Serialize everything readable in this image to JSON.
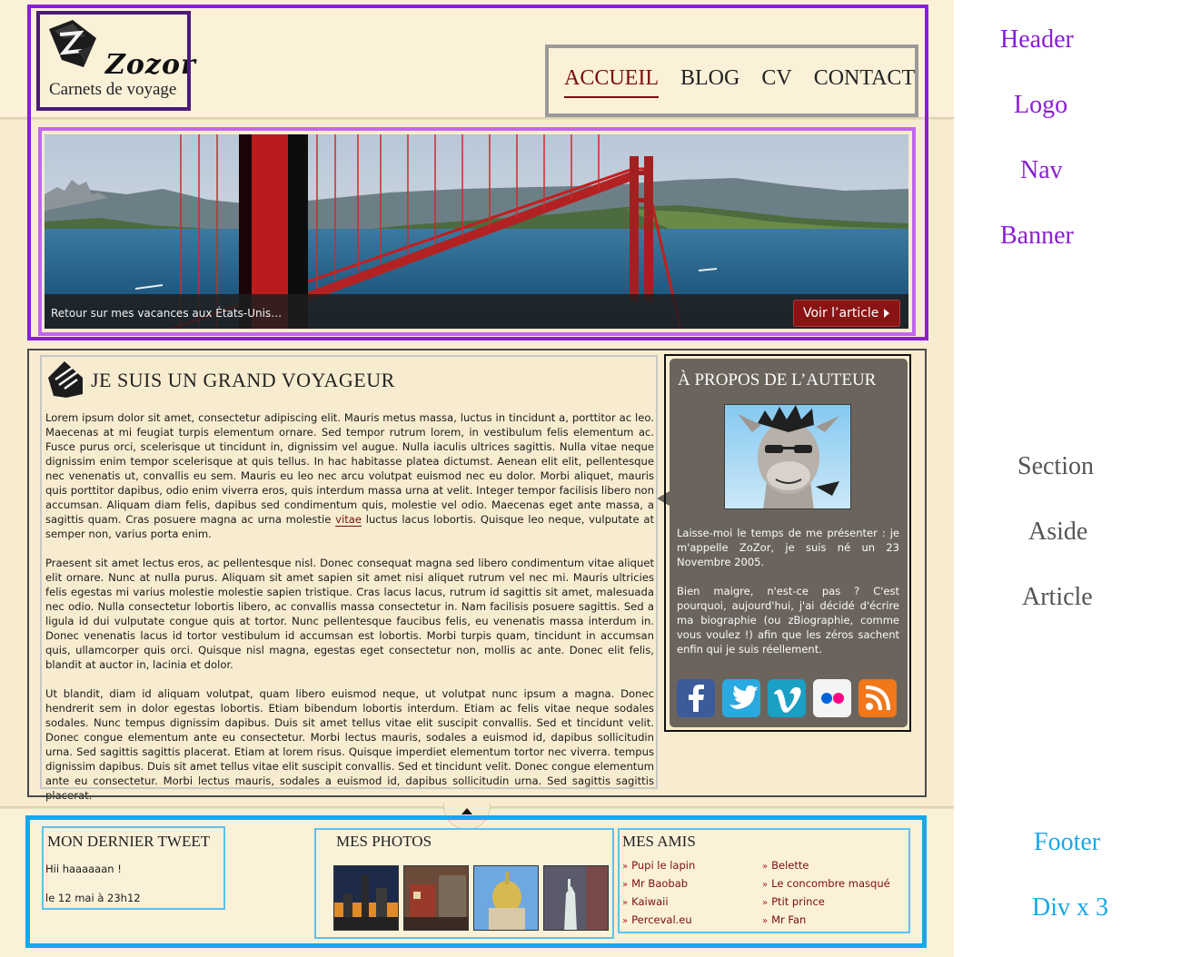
{
  "logo": {
    "name": "Zozor",
    "tagline": "Carnets de voyage"
  },
  "nav": {
    "items": [
      {
        "label": "ACCUEIL",
        "active": true
      },
      {
        "label": "BLOG",
        "active": false
      },
      {
        "label": "CV",
        "active": false
      },
      {
        "label": "CONTACT",
        "active": false
      }
    ]
  },
  "banner": {
    "caption": "Retour sur mes vacances aux États-Unis…",
    "button_label": "Voir l’article"
  },
  "article": {
    "title": "JE SUIS UN GRAND VOYAGEUR",
    "p1_before": "Lorem ipsum dolor sit amet, consectetur adipiscing elit. Mauris metus massa, luctus in tincidunt a, porttitor ac leo. Maecenas at mi feugiat turpis elementum ornare. Sed tempor rutrum lorem, in vestibulum felis elementum ac. Fusce purus orci, scelerisque ut tincidunt in, dignissim vel augue. Nulla iaculis ultrices sagittis. Nulla vitae neque dignissim enim tempor scelerisque at quis tellus. In hac habitasse platea dictumst. Aenean elit elit, pellentesque nec venenatis ut, convallis eu sem. Mauris eu leo nec arcu volutpat euismod nec eu dolor. Morbi aliquet, mauris quis porttitor dapibus, odio enim viverra eros, quis interdum massa urna at velit. Integer tempor facilisis libero non accumsan. Aliquam diam felis, dapibus sed condimentum quis, molestie vel odio. Maecenas eget ante massa, a sagittis quam. Cras posuere magna ac urna molestie ",
    "p1_link": "vitae",
    "p1_after": " luctus lacus lobortis. Quisque leo neque, vulputate at semper non, varius porta enim.",
    "p2": "Praesent sit amet lectus eros, ac pellentesque nisl. Donec consequat magna sed libero condimentum vitae aliquet elit ornare. Nunc at nulla purus. Aliquam sit amet sapien sit amet nisi aliquet rutrum vel nec mi. Mauris ultricies felis egestas mi varius molestie molestie sapien tristique. Cras lacus lacus, rutrum id sagittis sit amet, malesuada nec odio. Nulla consectetur lobortis libero, ac convallis massa consectetur in. Nam facilisis posuere sagittis. Sed a ligula id dui vulputate congue quis at tortor. Nunc pellentesque faucibus felis, eu venenatis massa interdum in. Donec venenatis lacus id tortor vestibulum id accumsan est lobortis. Morbi turpis quam, tincidunt in accumsan quis, ullamcorper quis orci. Quisque nisl magna, egestas eget consectetur non, mollis ac ante. Donec elit felis, blandit at auctor in, lacinia et dolor.",
    "p3": "Ut blandit, diam id aliquam volutpat, quam libero euismod neque, ut volutpat nunc ipsum a magna. Donec hendrerit sem in dolor egestas lobortis. Etiam bibendum lobortis interdum. Etiam ac felis vitae neque sodales sodales. Nunc tempus dignissim dapibus. Duis sit amet tellus vitae elit suscipit convallis. Sed et tincidunt velit. Donec congue elementum ante eu consectetur. Morbi lectus mauris, sodales a euismod id, dapibus sollicitudin urna. Sed sagittis sagittis placerat. Etiam at lorem risus. Quisque imperdiet elementum tortor nec viverra. tempus dignissim dapibus. Duis sit amet tellus vitae elit suscipit convallis. Sed et tincidunt velit. Donec congue elementum ante eu consectetur. Morbi lectus mauris, sodales a euismod id, dapibus sollicitudin urna. Sed sagittis sagittis placerat."
  },
  "aside": {
    "title": "À PROPOS DE L’AUTEUR",
    "p1": "Laisse-moi le temps de me présenter : je m'appelle ZoZor, je suis né un 23 Novembre 2005.",
    "p2": "Bien maigre, n'est-ce pas ? C'est pourquoi, aujourd'hui, j'ai décidé d'écrire ma biographie (ou zBiographie, comme vous voulez !) afin que les zéros sachent enfin qui je suis réellement.",
    "social": [
      {
        "icon": "facebook-icon",
        "color": "#3b5b9a"
      },
      {
        "icon": "twitter-icon",
        "color": "#2aa9e0"
      },
      {
        "icon": "vimeo-icon",
        "color": "#19a0c4"
      },
      {
        "icon": "flickr-icon",
        "color": "#f4f4f4"
      },
      {
        "icon": "rss-icon",
        "color": "#f0771a"
      }
    ]
  },
  "footer": {
    "tweet_title": "MON DERNIER TWEET",
    "tweet_text": "Hii haaaaaan !",
    "tweet_date": "le 12 mai à 23h12",
    "photos_title": "MES PHOTOS",
    "friends_title": "MES AMIS",
    "friends_col1": [
      "Pupi le lapin",
      "Mr Baobab",
      "Kaiwaii",
      "Perceval.eu"
    ],
    "friends_col2": [
      "Belette",
      "Le concombre masqué",
      "Ptit prince",
      "Mr Fan"
    ]
  },
  "labels": {
    "header": "Header",
    "logo": "Logo",
    "nav": "Nav",
    "banner": "Banner",
    "section": "Section",
    "aside": "Aside",
    "article": "Article",
    "footer": "Footer",
    "divs": "Div x 3"
  },
  "colors": {
    "header": "#8a1ed6",
    "section_labels": "#555555",
    "footer": "#19a7e8",
    "accent": "#7a0d0d"
  }
}
